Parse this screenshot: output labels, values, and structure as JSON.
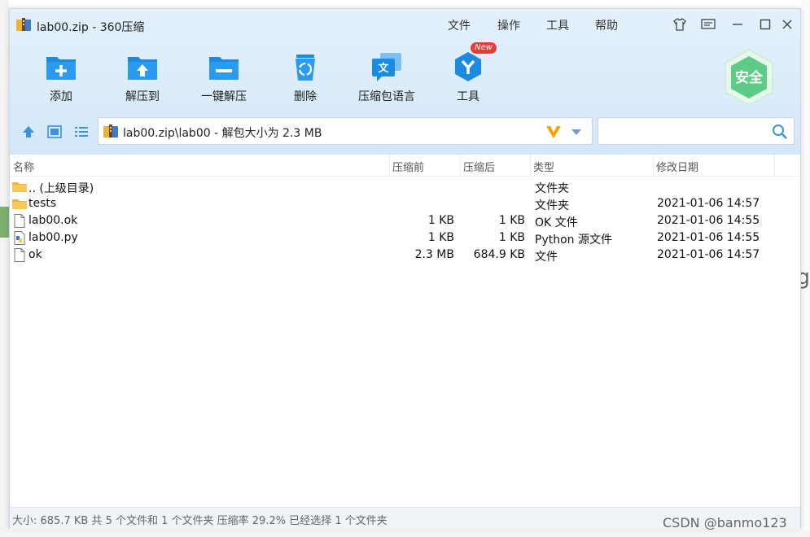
{
  "window": {
    "title": "lab00.zip - 360压缩"
  },
  "menu": {
    "file": "文件",
    "operate": "操作",
    "tools": "工具",
    "help": "帮助"
  },
  "toolbar": {
    "add": "添加",
    "extract_to": "解压到",
    "one_click_extract": "一键解压",
    "delete": "删除",
    "language": "压缩包语言",
    "tools": "工具",
    "new_badge": "New",
    "security_badge": "安全"
  },
  "address": {
    "path": "lab00.zip\\lab00 - 解包大小为 2.3 MB"
  },
  "search": {
    "placeholder": ""
  },
  "columns": {
    "name": "名称",
    "compressed_before": "压缩前",
    "compressed_after": "压缩后",
    "type": "类型",
    "modified": "修改日期"
  },
  "files": [
    {
      "name": ".. (上级目录)",
      "before": "",
      "after": "",
      "type": "文件夹",
      "date": "",
      "icon": "folder-icon"
    },
    {
      "name": "tests",
      "before": "",
      "after": "",
      "type": "文件夹",
      "date": "2021-01-06 14:57",
      "icon": "folder-icon"
    },
    {
      "name": "lab00.ok",
      "before": "1 KB",
      "after": "1 KB",
      "type": "OK 文件",
      "date": "2021-01-06 14:55",
      "icon": "file-icon"
    },
    {
      "name": "lab00.py",
      "before": "1 KB",
      "after": "1 KB",
      "type": "Python 源文件",
      "date": "2021-01-06 14:55",
      "icon": "python-file-icon"
    },
    {
      "name": "ok",
      "before": "2.3 MB",
      "after": "684.9 KB",
      "type": "文件",
      "date": "2021-01-06 14:57",
      "icon": "file-icon"
    }
  ],
  "status": {
    "text": "大小: 685.7 KB 共 5 个文件和 1 个文件夹 压缩率 29.2% 已经选择 1 个文件夹"
  },
  "watermark": "CSDN @banmo123",
  "colors": {
    "accent": "#1a8be0",
    "header_bg": "#dcecfa",
    "folder": "#f5c04a",
    "shield": "#4cc478"
  }
}
